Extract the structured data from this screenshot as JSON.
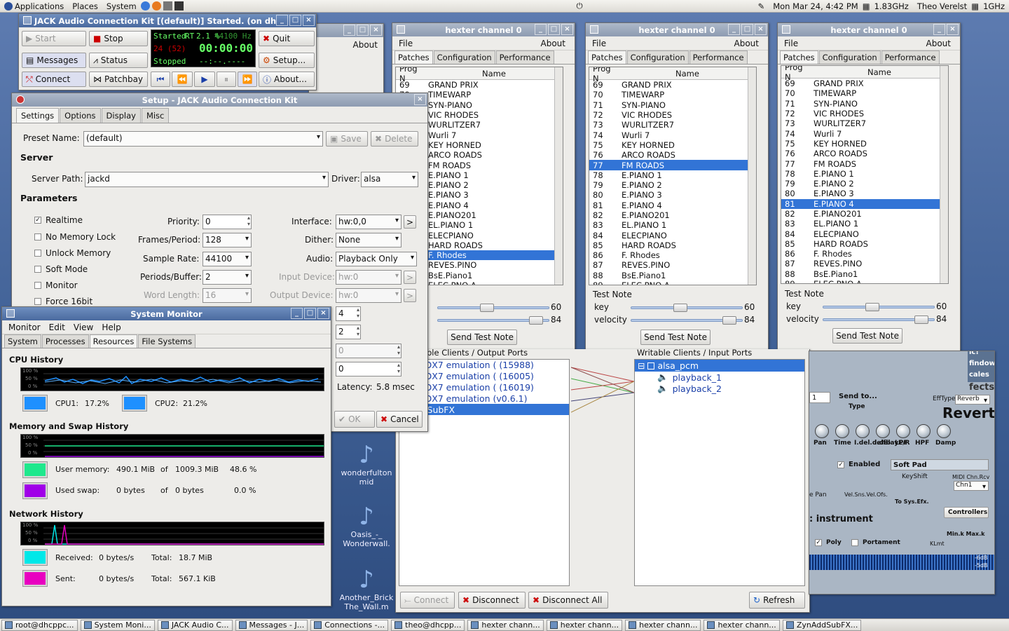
{
  "topbar": {
    "applications": "Applications",
    "places": "Places",
    "system": "System",
    "clock": "Mon Mar 24,  4:42 PM",
    "cpu_freq": "1.83GHz",
    "user": "Theo Verelst",
    "cpu2_freq": "1GHz"
  },
  "jack": {
    "title": "JACK Audio Connection Kit [(default)] Started. (on dh",
    "start": "Start",
    "stop": "Stop",
    "quit": "Quit",
    "messages": "Messages",
    "status": "Status",
    "setup": "Setup...",
    "connect": "Connect",
    "patchbay": "Patchbay",
    "about": "About...",
    "display_status": "Started",
    "display_rt": "RT",
    "display_load": "2.1 %",
    "display_rate": "44100 Hz",
    "display_xruns": "24 (52)",
    "display_time": "00:00:00",
    "display_stopped": "Stopped",
    "display_dashes": "--:--.----"
  },
  "setup": {
    "title": "Setup - JACK Audio Connection Kit",
    "tabs": [
      "Settings",
      "Options",
      "Display",
      "Misc"
    ],
    "preset_label": "Preset Name:",
    "preset_value": "(default)",
    "save": "Save",
    "delete": "Delete",
    "server_hdr": "Server",
    "server_path_label": "Server Path:",
    "server_path": "jackd",
    "driver_label": "Driver:",
    "driver": "alsa",
    "params_hdr": "Parameters",
    "realtime": "Realtime",
    "no_memory_lock": "No Memory Lock",
    "unlock_memory": "Unlock Memory",
    "soft_mode": "Soft Mode",
    "monitor": "Monitor",
    "force16": "Force 16bit",
    "priority_label": "Priority:",
    "priority": "0",
    "frames_label": "Frames/Period:",
    "frames": "128",
    "rate_label": "Sample Rate:",
    "rate": "44100",
    "periods_label": "Periods/Buffer:",
    "periods": "2",
    "wordlen_label": "Word Length:",
    "wordlen": "16",
    "interface_label": "Interface:",
    "interface": "hw:0,0",
    "dither_label": "Dither:",
    "dither": "None",
    "audio_label": "Audio:",
    "audio": "Playback Only",
    "input_label": "Input Device:",
    "input": "hw:0",
    "output_label": "Output Device:",
    "output": "hw:0",
    "spin4": "4",
    "spin2": "2",
    "spin0a": "0",
    "spin0b": "0",
    "latency_label": "Latency:",
    "latency": "5.8 msec",
    "ok": "OK",
    "cancel": "Cancel"
  },
  "sysmon": {
    "title": "System Monitor",
    "menu": [
      "Monitor",
      "Edit",
      "View",
      "Help"
    ],
    "tabs": [
      "System",
      "Processes",
      "Resources",
      "File Systems"
    ],
    "cpu_hdr": "CPU History",
    "cpu1_label": "CPU1:",
    "cpu1": "17.2%",
    "cpu2_label": "CPU2:",
    "cpu2": "21.2%",
    "mem_hdr": "Memory and Swap History",
    "user_mem_label": "User memory:",
    "user_mem": "490.1 MiB",
    "of": "of",
    "user_mem_total": "1009.3 MiB",
    "user_mem_pct": "48.6 %",
    "swap_label": "Used swap:",
    "swap": "0 bytes",
    "swap_total": "0 bytes",
    "swap_pct": "0.0 %",
    "net_hdr": "Network History",
    "recv_label": "Received:",
    "recv": "0 bytes/s",
    "total_label": "Total:",
    "recv_total": "18.7 MiB",
    "sent_label": "Sent:",
    "sent": "0 bytes/s",
    "sent_total": "567.1 KiB",
    "g100": "100 %",
    "g50": "50 %",
    "g0": "0 %",
    "colors": {
      "cpu": "#1e90ff",
      "user_mem": "#1ee88c",
      "swap": "#a000e8",
      "recv": "#00e8e8",
      "sent": "#e800c0"
    }
  },
  "hexter": {
    "title": "hexter channel 0",
    "file": "File",
    "about": "About",
    "tabs": [
      "Patches",
      "Configuration",
      "Performance"
    ],
    "col_prog": "Prog N",
    "col_name": "Name",
    "test_note": "Test Note",
    "key_label": "key",
    "key": "60",
    "vel_label": "velocity",
    "vel": "84",
    "send": "Send Test Note",
    "w1_rows": [
      [
        "69",
        "GRAND PRIX"
      ],
      [
        "70",
        "TIMEWARP"
      ],
      [
        "",
        "SYN-PIANO"
      ],
      [
        "",
        "VIC RHODES"
      ],
      [
        "",
        "WURLITZER7"
      ],
      [
        "",
        "Wurli    7"
      ],
      [
        "",
        "KEY HORNED"
      ],
      [
        "",
        "ARCO ROADS"
      ],
      [
        "",
        "FM ROADS"
      ],
      [
        "",
        "E.PIANO 1"
      ],
      [
        "",
        "E.PIANO 2"
      ],
      [
        "",
        "E.PIANO 3"
      ],
      [
        "",
        "E.PIANO 4"
      ],
      [
        "",
        "E.PIANO201"
      ],
      [
        "",
        "EL.PIANO 1"
      ],
      [
        "",
        "ELECPIANO"
      ],
      [
        "",
        "HARD ROADS"
      ],
      [
        "",
        "F. Rhodes"
      ],
      [
        "",
        "REVES.PINO"
      ],
      [
        "",
        "BsE.Piano1"
      ],
      [
        "",
        "ELEC PNO A"
      ]
    ],
    "w2_rows": [
      [
        "69",
        "GRAND PRIX"
      ],
      [
        "70",
        "TIMEWARP"
      ],
      [
        "71",
        "SYN-PIANO"
      ],
      [
        "72",
        "VIC RHODES"
      ],
      [
        "73",
        "WURLITZER7"
      ],
      [
        "74",
        "Wurli    7"
      ],
      [
        "75",
        "KEY HORNED"
      ],
      [
        "76",
        "ARCO ROADS"
      ],
      [
        "77",
        "FM ROADS"
      ],
      [
        "78",
        "E.PIANO 1"
      ],
      [
        "79",
        "E.PIANO 2"
      ],
      [
        "80",
        "E.PIANO 3"
      ],
      [
        "81",
        "E.PIANO 4"
      ],
      [
        "82",
        "E.PIANO201"
      ],
      [
        "83",
        "EL.PIANO 1"
      ],
      [
        "84",
        "ELECPIANO"
      ],
      [
        "85",
        "HARD ROADS"
      ],
      [
        "86",
        "F. Rhodes"
      ],
      [
        "87",
        "REVES.PINO"
      ],
      [
        "88",
        "BsE.Piano1"
      ],
      [
        "89",
        "ELEC PNO A"
      ]
    ],
    "w3_rows": [
      [
        "69",
        "GRAND PRIX"
      ],
      [
        "70",
        "TIMEWARP"
      ],
      [
        "71",
        "SYN-PIANO"
      ],
      [
        "72",
        "VIC RHODES"
      ],
      [
        "73",
        "WURLITZER7"
      ],
      [
        "74",
        "Wurli    7"
      ],
      [
        "75",
        "KEY HORNED"
      ],
      [
        "76",
        "ARCO ROADS"
      ],
      [
        "77",
        "FM ROADS"
      ],
      [
        "78",
        "E.PIANO 1"
      ],
      [
        "79",
        "E.PIANO 2"
      ],
      [
        "80",
        "E.PIANO 3"
      ],
      [
        "81",
        "E.PIANO 4"
      ],
      [
        "82",
        "E.PIANO201"
      ],
      [
        "83",
        "EL.PIANO 1"
      ],
      [
        "84",
        "ELECPIANO"
      ],
      [
        "85",
        "HARD ROADS"
      ],
      [
        "86",
        "F. Rhodes"
      ],
      [
        "87",
        "REVES.PINO"
      ],
      [
        "88",
        "BsE.Piano1"
      ],
      [
        "89",
        "ELEC PNO A"
      ]
    ]
  },
  "connections": {
    "readable_hdr": "ble Clients / Output Ports",
    "writable_hdr": "Writable Clients / Input Ports",
    "readable": [
      "exter DX7 emulation ( (15988)",
      "exter DX7 emulation ( (16005)",
      "exter DX7 emulation ( (16019)",
      "exter DX7 emulation (v0.6.1)",
      "ynAddSubFX"
    ],
    "alsa_pcm": "alsa_pcm",
    "playback_1": "playback_1",
    "playback_2": "playback_2",
    "connect": "Connect",
    "disconnect": "Disconnect",
    "disconnect_all": "Disconnect All",
    "refresh": "Refresh"
  },
  "desktop_icons": [
    {
      "line1": "wonderfulton",
      "line2": "mid"
    },
    {
      "line1": "Oasis_-_",
      "line2": "Wonderwall."
    },
    {
      "line1": "Another_Brick",
      "line2": "The_Wall.m"
    }
  ],
  "zyn": {
    "send_to": "Send to...",
    "type": "Type",
    "efftype": "EffType",
    "reverb": "Reverb",
    "reverb_big": "Revert",
    "knobs": [
      "Pan",
      "Time",
      "I.del.delfb",
      "I.delayE/R",
      "LPF",
      "HPF",
      "Damp"
    ],
    "enabled": "Enabled",
    "soft_pad": "Soft Pad",
    "keyshift": "KeyShift",
    "midi": "MIDI Chn.Rcv",
    "chn": "Chn1",
    "pan": "e Pan",
    "vel": "Vel.Sns.Vel.Ofs.",
    "to_sys": "To Sys.Efx.",
    "instrument": ": instrument",
    "controllers": "Controllers",
    "poly": "Poly",
    "portament": "Portament",
    "klmt": "KLmt",
    "minmax": "Min.k  Max.k",
    "db1": "-6dB",
    "db2": "-5dB",
    "side": [
      "ic!",
      "findow",
      "cales",
      "fects"
    ]
  },
  "taskbar": [
    "root@dhcppc...",
    "System Moni...",
    "JACK Audio C...",
    "Messages - J...",
    "Connections -...",
    "theo@dhcpp...",
    "hexter chann...",
    "hexter chann...",
    "hexter chann...",
    "hexter chann...",
    "ZynAddSubFX..."
  ]
}
